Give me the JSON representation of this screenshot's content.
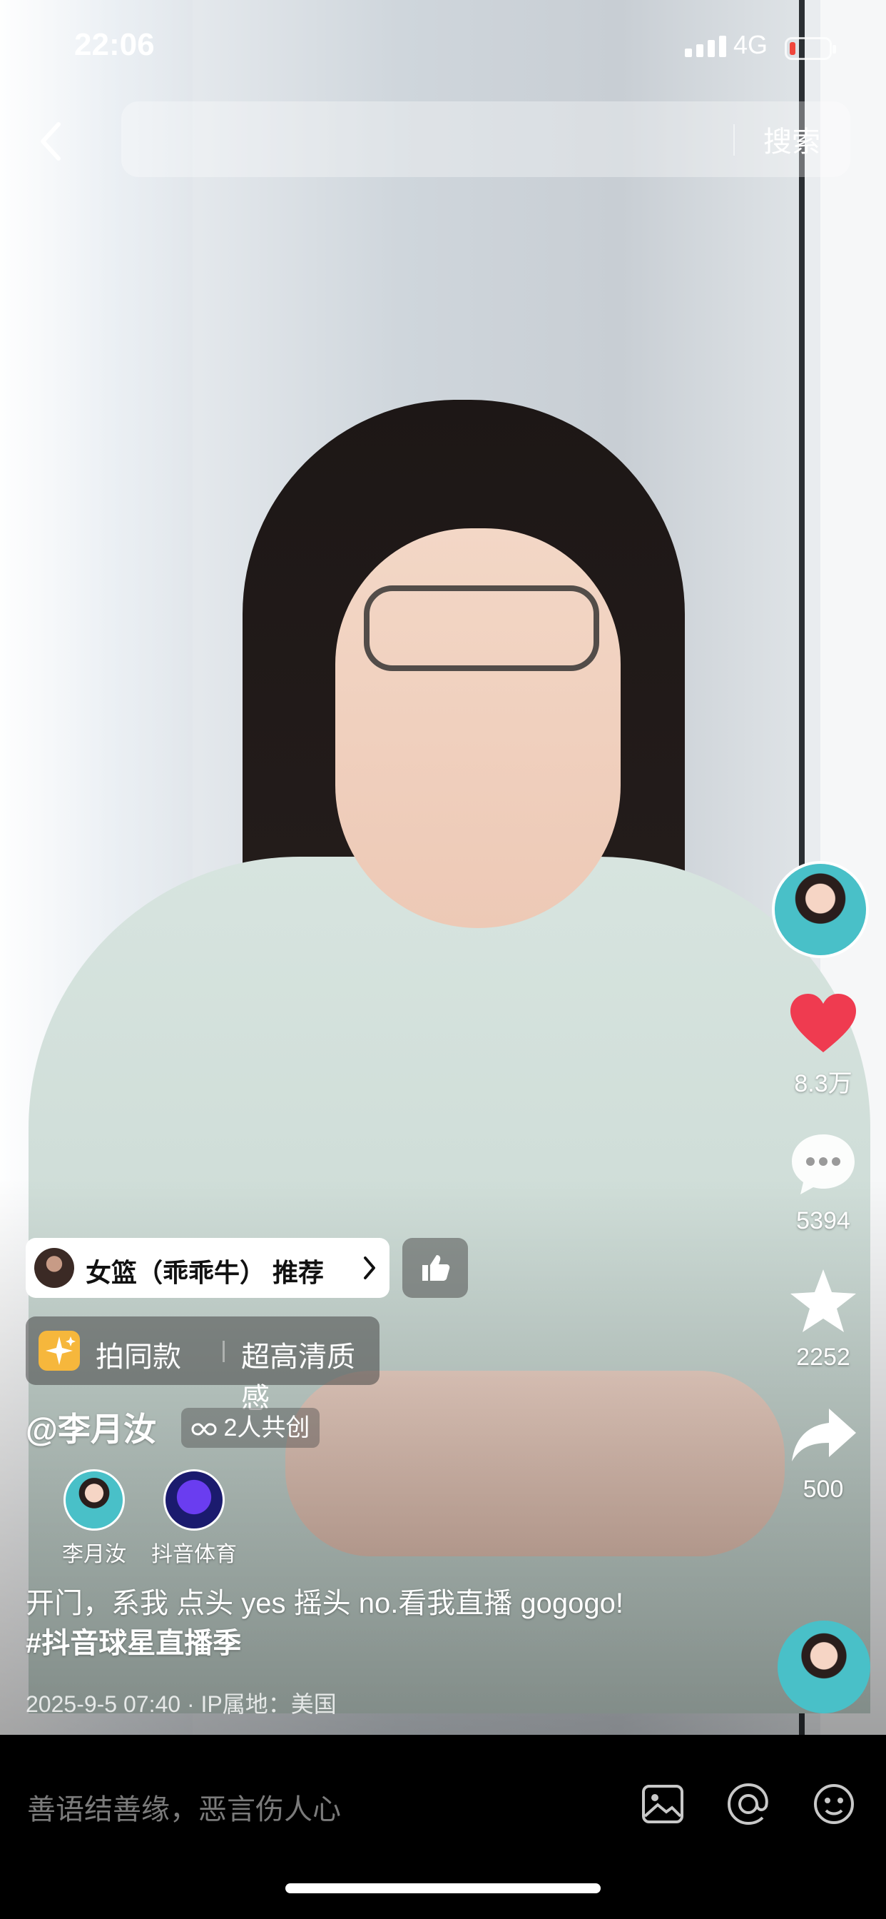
{
  "status_bar": {
    "time": "22:06",
    "network": "4G"
  },
  "search": {
    "placeholder": "",
    "button": "搜索"
  },
  "side_actions": {
    "likes": "8.3万",
    "comments": "5394",
    "favorites": "2252",
    "shares": "500"
  },
  "recommend": {
    "label": "女篮（乖乖牛） 推荐"
  },
  "same_style": {
    "label": "拍同款",
    "tag": "超高清质感"
  },
  "author": {
    "handle": "@李月汝",
    "co_create": "2人共创"
  },
  "creators": [
    {
      "name": "李月汝"
    },
    {
      "name": "抖音体育"
    }
  ],
  "caption": {
    "text": "开门，系我 点头 yes 摇头 no.看我直播 gogogo!",
    "hashtag": "#抖音球星直播季"
  },
  "meta": "2025-9-5 07:40 · IP属地：美国",
  "comment_input": {
    "placeholder": "善语结善缘，恶言伤人心"
  },
  "colors": {
    "like_red": "#ef3b50",
    "battery_low": "#f0463c"
  }
}
